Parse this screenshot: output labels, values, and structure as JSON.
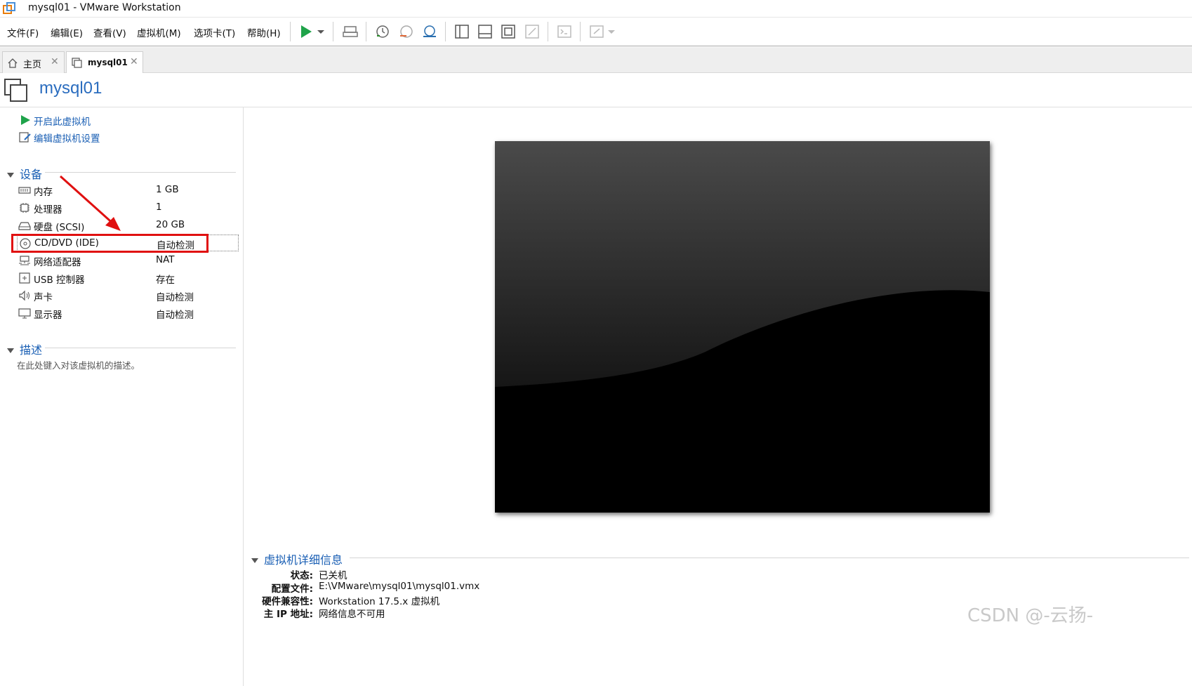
{
  "window": {
    "title": "mysql01 - VMware Workstation"
  },
  "menu": {
    "file": "文件(F)",
    "edit": "编辑(E)",
    "view": "查看(V)",
    "vm": "虚拟机(M)",
    "tabs": "选项卡(T)",
    "help": "帮助(H)"
  },
  "tabs": [
    {
      "label": "主页",
      "active": false
    },
    {
      "label": "mysql01",
      "active": true
    }
  ],
  "vm": {
    "name": "mysql01"
  },
  "actions": {
    "power_on": "开启此虚拟机",
    "edit_settings": "编辑虚拟机设置"
  },
  "devices": {
    "heading": "设备",
    "items": [
      {
        "name": "内存",
        "value": "1 GB",
        "icon": "memory-icon"
      },
      {
        "name": "处理器",
        "value": "1",
        "icon": "processor-icon"
      },
      {
        "name": "硬盘 (SCSI)",
        "value": "20 GB",
        "icon": "harddisk-icon"
      },
      {
        "name": "CD/DVD (IDE)",
        "value": "自动检测",
        "icon": "cd-dvd-icon"
      },
      {
        "name": "网络适配器",
        "value": "NAT",
        "icon": "network-icon"
      },
      {
        "name": "USB 控制器",
        "value": "存在",
        "icon": "usb-icon"
      },
      {
        "name": "声卡",
        "value": "自动检测",
        "icon": "sound-icon"
      },
      {
        "name": "显示器",
        "value": "自动检测",
        "icon": "display-icon"
      }
    ]
  },
  "description": {
    "heading": "描述",
    "placeholder": "在此处键入对该虚拟机的描述。"
  },
  "details": {
    "heading": "虚拟机详细信息",
    "rows": [
      {
        "key": "状态:",
        "value": "已关机"
      },
      {
        "key": "配置文件:",
        "value": "E:\\VMware\\mysql01\\mysql01.vmx"
      },
      {
        "key": "硬件兼容性:",
        "value": "Workstation 17.5.x 虚拟机"
      },
      {
        "key": "主 IP 地址:",
        "value": "网络信息不可用"
      }
    ]
  },
  "watermark": "CSDN @-云扬-",
  "colors": {
    "link": "#1a5fb4",
    "play": "#1fa34a",
    "annotation": "#e01010"
  }
}
